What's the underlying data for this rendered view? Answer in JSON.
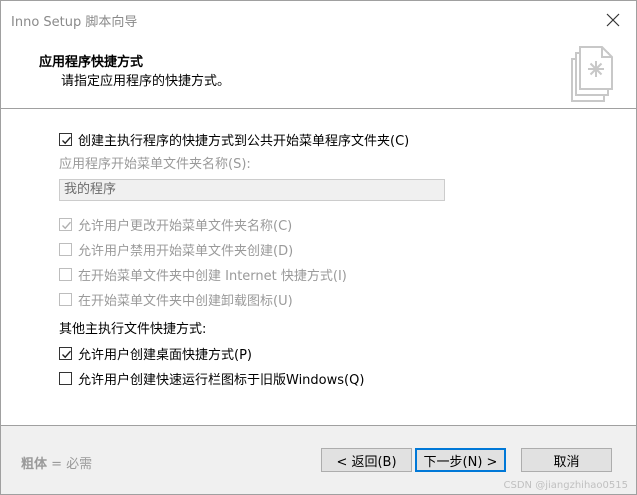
{
  "window": {
    "title": "Inno Setup 脚本向导"
  },
  "header": {
    "title": "应用程序快捷方式",
    "subtitle": "请指定应用程序的快捷方式。"
  },
  "options": {
    "create_public_start_menu": {
      "label": "创建主执行程序的快捷方式到公共开始菜单程序文件夹(C)",
      "checked": true,
      "enabled": true
    },
    "folder_name_label": "应用程序开始菜单文件夹名称(S):",
    "folder_name_value": "我的程序",
    "allow_change_folder": {
      "label": "允许用户更改开始菜单文件夹名称(C)",
      "checked": true,
      "enabled": false
    },
    "allow_disable_folder": {
      "label": "允许用户禁用开始菜单文件夹创建(D)",
      "checked": false,
      "enabled": false
    },
    "internet_shortcut": {
      "label": "在开始菜单文件夹中创建 Internet 快捷方式(I)",
      "checked": false,
      "enabled": false
    },
    "uninstall_icon": {
      "label": "在开始菜单文件夹中创建卸载图标(U)",
      "checked": false,
      "enabled": false
    },
    "other_shortcuts_label": "其他主执行文件快捷方式:",
    "desktop_shortcut": {
      "label": "允许用户创建桌面快捷方式(P)",
      "checked": true,
      "enabled": true
    },
    "quicklaunch_shortcut": {
      "label": "允许用户创建快速运行栏图标于旧版Windows(Q)",
      "checked": false,
      "enabled": true
    }
  },
  "footer": {
    "legend_bold": "粗体",
    "legend_rest": " = 必需",
    "back_label": "< 返回(B)",
    "next_label": "下一步(N) >",
    "cancel_label": "取消"
  },
  "watermark": "CSDN @jiangzhihao0515",
  "icons": {
    "close": "close-icon",
    "wizard": "wizard-document-icon",
    "check": "checkmark-icon"
  }
}
